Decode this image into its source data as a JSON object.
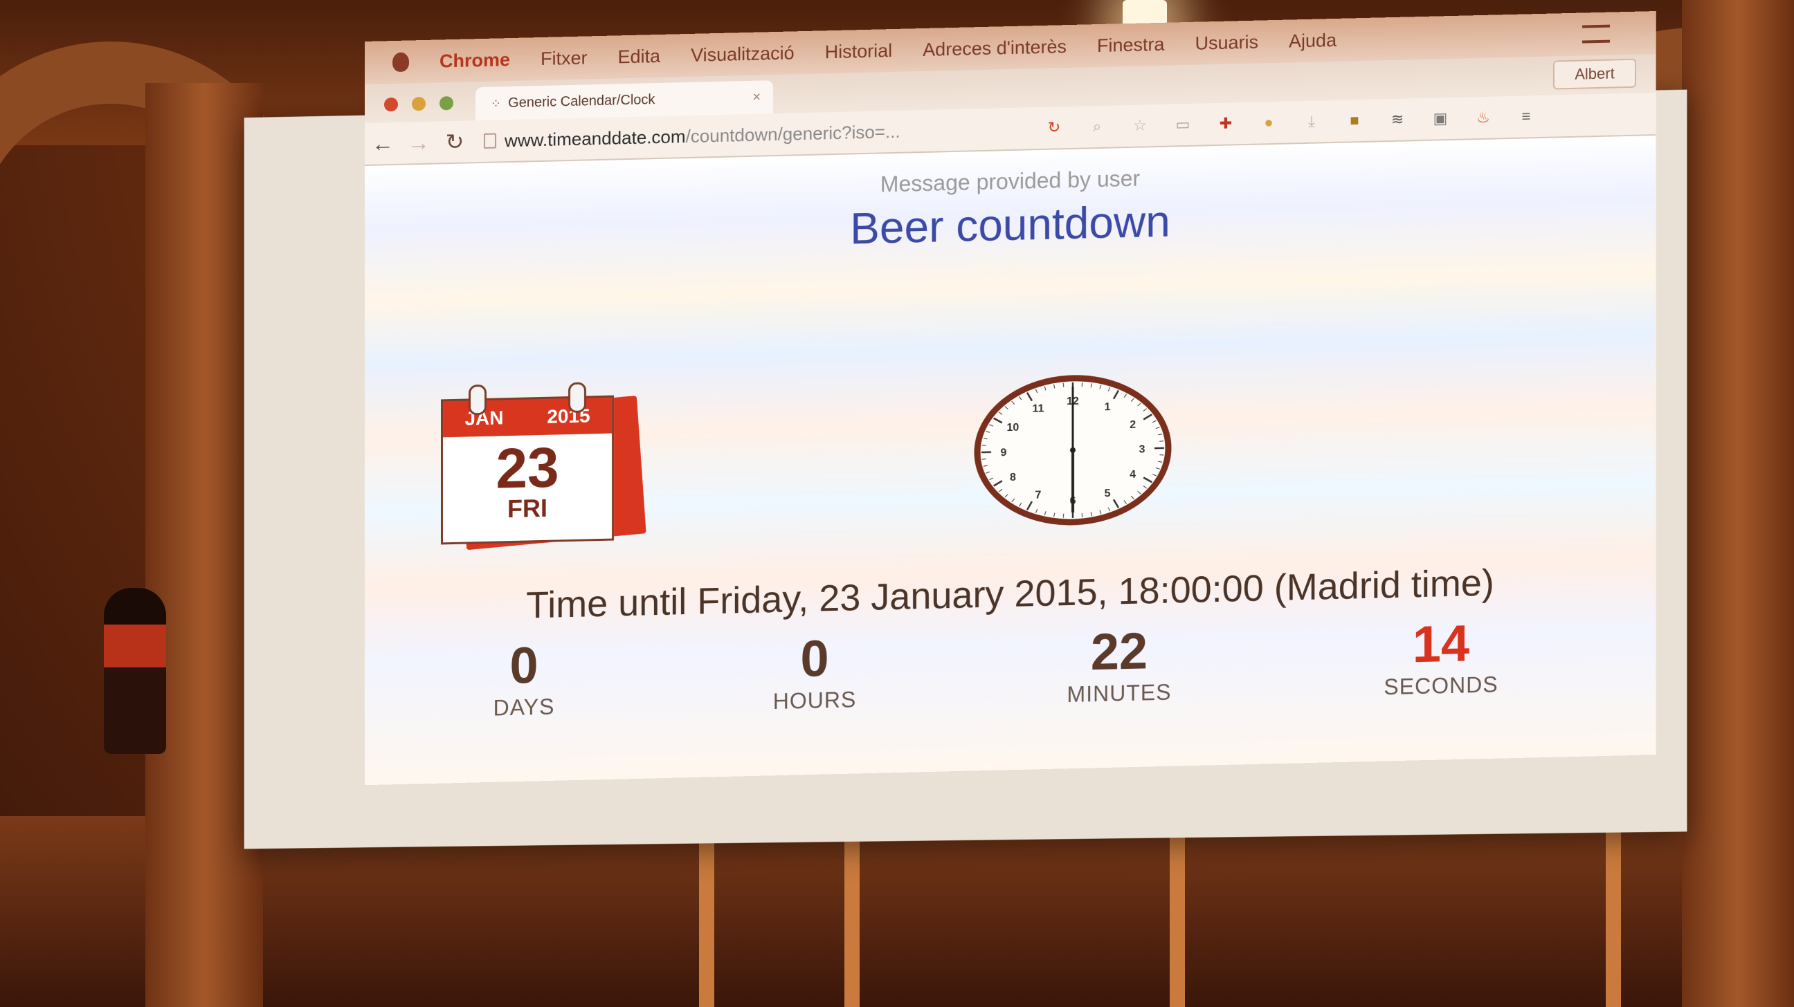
{
  "menubar": {
    "app_name": "Chrome",
    "items": [
      "Fitxer",
      "Edita",
      "Visualització",
      "Historial",
      "Adreces d'interès",
      "Finestra",
      "Usuaris",
      "Ajuda"
    ]
  },
  "tab": {
    "title": "Generic Calendar/Clock",
    "close_glyph": "×"
  },
  "user": {
    "name": "Albert"
  },
  "toolbar": {
    "back_glyph": "←",
    "forward_glyph": "→",
    "reload_glyph": "↻",
    "url_host": "www.timeanddate.com",
    "url_path": "/countdown/generic?iso=..."
  },
  "extensions": [
    {
      "name": "refresh-extension-icon",
      "glyph": "↻",
      "color": "#d8361e"
    },
    {
      "name": "search-icon",
      "glyph": "⌕",
      "color": "#c9b0a4"
    },
    {
      "name": "bookmark-star-icon",
      "glyph": "☆",
      "color": "#c9b0a4"
    },
    {
      "name": "screen-icon",
      "glyph": "▭",
      "color": "#b59f93"
    },
    {
      "name": "pinterest-icon",
      "glyph": "✚",
      "color": "#c0321e"
    },
    {
      "name": "cookie-icon",
      "glyph": "●",
      "color": "#d8a23a"
    },
    {
      "name": "download-icon",
      "glyph": "⤓",
      "color": "#c9b0a4"
    },
    {
      "name": "app-square-icon",
      "glyph": "■",
      "color": "#b07a1e"
    },
    {
      "name": "layers-icon",
      "glyph": "≋",
      "color": "#5a5a5a"
    },
    {
      "name": "cast-icon",
      "glyph": "▣",
      "color": "#7a7a7a"
    },
    {
      "name": "fire-icon",
      "glyph": "♨",
      "color": "#d8561e"
    },
    {
      "name": "menu-icon",
      "glyph": "≡",
      "color": "#6a6a6a"
    }
  ],
  "page": {
    "message_label": "Message provided by user",
    "message_title": "Beer countdown",
    "calendar": {
      "month": "JAN",
      "year": "2015",
      "day": "23",
      "weekday": "FRI"
    },
    "clock": {
      "numbers": [
        "12",
        "1",
        "2",
        "3",
        "4",
        "5",
        "6",
        "7",
        "8",
        "9",
        "10",
        "11"
      ],
      "time": "18:00"
    },
    "until_text": "Time until Friday, 23 January 2015, 18:00:00 (Madrid time)",
    "countdown": [
      {
        "value": "0",
        "unit": "DAYS"
      },
      {
        "value": "0",
        "unit": "HOURS"
      },
      {
        "value": "22",
        "unit": "MINUTES"
      },
      {
        "value": "14",
        "unit": "SECONDS"
      }
    ]
  }
}
